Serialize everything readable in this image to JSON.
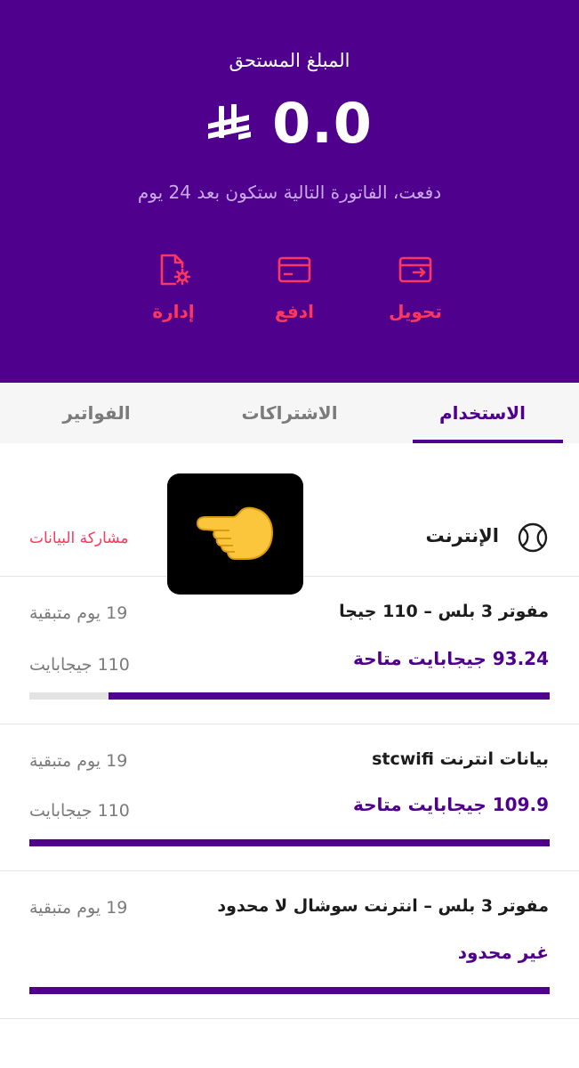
{
  "header": {
    "amount_label": "المبلغ المستحق",
    "amount_value": "0.0",
    "currency_icon": "riyal-symbol-icon",
    "next_invoice_text": "دفعت، الفاتورة التالية ستكون بعد 24 يوم",
    "actions": [
      {
        "label": "تحويل",
        "icon": "transfer-card-icon"
      },
      {
        "label": "ادفع",
        "icon": "credit-card-icon"
      },
      {
        "label": "إدارة",
        "icon": "document-settings-icon"
      }
    ]
  },
  "tabs": [
    {
      "label": "الاستخدام",
      "active": true
    },
    {
      "label": "الاشتراكات",
      "active": false
    },
    {
      "label": "الفواتير",
      "active": false
    }
  ],
  "internet_section": {
    "title": "الإنترنت",
    "icon": "globe-icon",
    "share_link": "مشاركة البيانات"
  },
  "overlay": {
    "icon": "pointing-hand-emoji"
  },
  "plans": [
    {
      "name": "مفوتر 3 بلس – 110 جيجا",
      "days_left": "19 يوم متبقية",
      "available": "93.24 جيجابايت متاحة",
      "total": "110 جيجابايت",
      "remaining_fraction": 0.848
    },
    {
      "name": "بيانات انترنت stcwifi",
      "days_left": "19 يوم متبقية",
      "available": "109.9 جيجابايت متاحة",
      "total": "110 جيجابايت",
      "remaining_fraction": 1.0
    },
    {
      "name": "مفوتر 3 بلس – انترنت سوشال لا محدود",
      "days_left": "19 يوم متبقية",
      "available": "غير محدود",
      "total": "",
      "remaining_fraction": 1.0
    }
  ],
  "colors": {
    "brand_purple": "#4f008c",
    "accent_pink": "#ff375e",
    "muted_gray": "#7b7b7b"
  }
}
